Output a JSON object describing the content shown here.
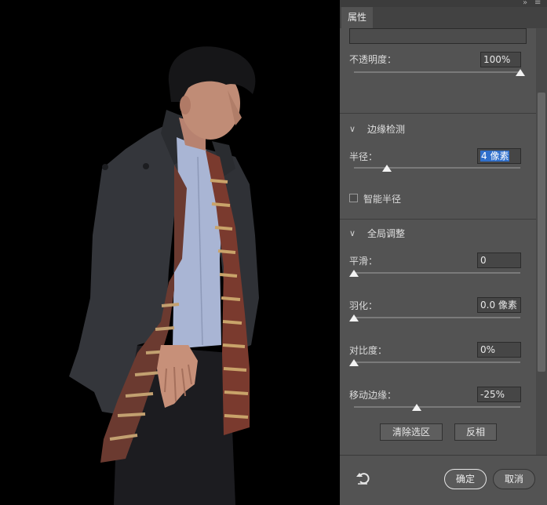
{
  "panel": {
    "tab_label": "属性",
    "collapse_icon": "»",
    "close_icon": "≡",
    "opacity": {
      "label": "不透明度：",
      "value": "100%",
      "level": 1.0
    },
    "edge_detection": {
      "title": "边缘检测",
      "radius": {
        "label": "半径：",
        "value": "4 像素",
        "level": 0.2
      },
      "smart_radius": {
        "label": "智能半径",
        "checked": false
      }
    },
    "global_adjust": {
      "title": "全局调整",
      "smooth": {
        "label": "平滑：",
        "value": "0",
        "level": 0.0
      },
      "feather": {
        "label": "羽化：",
        "value": "0.0 像素",
        "level": 0.0
      },
      "contrast": {
        "label": "对比度：",
        "value": "0%",
        "level": 0.0
      },
      "shift_edge": {
        "label": "移动边缘：",
        "value": "-25%",
        "level": 0.375
      }
    },
    "clear_selection_label": "清除选区",
    "invert_label": "反相",
    "ok_label": "确定",
    "cancel_label": "取消",
    "reset_icon": "reset-icon"
  }
}
